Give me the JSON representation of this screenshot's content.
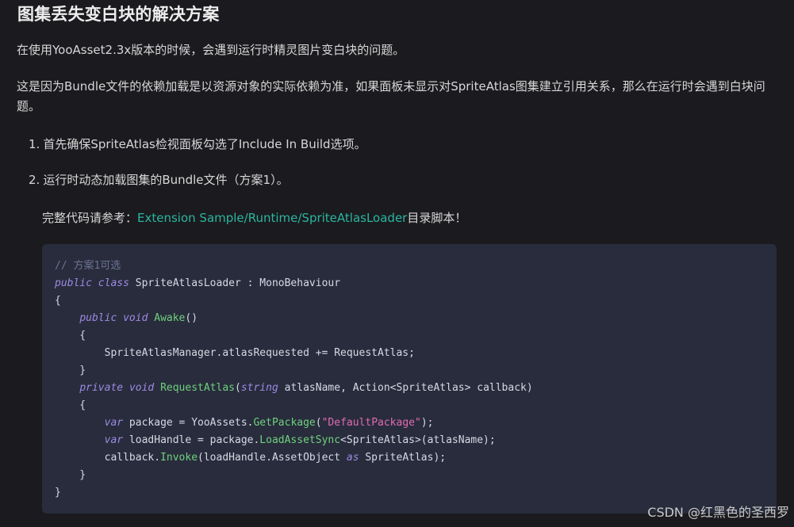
{
  "article": {
    "heading": "图集丢失变白块的解决方案",
    "paragraph1": "在使用YooAsset2.3x版本的时候，会遇到运行时精灵图片变白块的问题。",
    "paragraph2": "这是因为Bundle文件的依赖加载是以资源对象的实际依赖为准，如果面板未显示对SpriteAtlas图集建立引用关系，那么在运行时会遇到白块问题。",
    "list": [
      {
        "num": "1.",
        "text": "首先确保SpriteAtlas检视面板勾选了Include In Build选项。"
      },
      {
        "num": "2.",
        "text": "运行时动态加载图集的Bundle文件（方案1）。"
      }
    ],
    "ref_prefix": "完整代码请参考：",
    "ref_link": "Extension Sample/Runtime/SpriteAtlasLoader",
    "ref_suffix": "目录脚本！"
  },
  "code": {
    "language": "csharp",
    "lines": [
      [
        {
          "t": "// 方案1可选",
          "c": "comment"
        }
      ],
      [
        {
          "t": "public",
          "c": "kw"
        },
        {
          "t": " ",
          "c": "plain"
        },
        {
          "t": "class",
          "c": "kw"
        },
        {
          "t": " SpriteAtlasLoader : MonoBehaviour",
          "c": "plain"
        }
      ],
      [
        {
          "t": "{",
          "c": "plain"
        }
      ],
      [
        {
          "t": "    ",
          "c": "plain"
        },
        {
          "t": "public",
          "c": "kw"
        },
        {
          "t": " ",
          "c": "plain"
        },
        {
          "t": "void",
          "c": "kw"
        },
        {
          "t": " ",
          "c": "plain"
        },
        {
          "t": "Awake",
          "c": "fn"
        },
        {
          "t": "()",
          "c": "plain"
        }
      ],
      [
        {
          "t": "    {",
          "c": "plain"
        }
      ],
      [
        {
          "t": "        SpriteAtlasManager.atlasRequested += RequestAtlas;",
          "c": "plain"
        }
      ],
      [
        {
          "t": "    }",
          "c": "plain"
        }
      ],
      [
        {
          "t": "    ",
          "c": "plain"
        },
        {
          "t": "private",
          "c": "kw"
        },
        {
          "t": " ",
          "c": "plain"
        },
        {
          "t": "void",
          "c": "kw"
        },
        {
          "t": " ",
          "c": "plain"
        },
        {
          "t": "RequestAtlas",
          "c": "fn"
        },
        {
          "t": "(",
          "c": "plain"
        },
        {
          "t": "string",
          "c": "kw"
        },
        {
          "t": " atlasName, Action<SpriteAtlas> callback)",
          "c": "plain"
        }
      ],
      [
        {
          "t": "    {",
          "c": "plain"
        }
      ],
      [
        {
          "t": "        ",
          "c": "plain"
        },
        {
          "t": "var",
          "c": "kw"
        },
        {
          "t": " package = YooAssets.",
          "c": "plain"
        },
        {
          "t": "GetPackage",
          "c": "fn"
        },
        {
          "t": "(",
          "c": "plain"
        },
        {
          "t": "\"DefaultPackage\"",
          "c": "str"
        },
        {
          "t": ");",
          "c": "plain"
        }
      ],
      [
        {
          "t": "        ",
          "c": "plain"
        },
        {
          "t": "var",
          "c": "kw"
        },
        {
          "t": " loadHandle = package.",
          "c": "plain"
        },
        {
          "t": "LoadAssetSync",
          "c": "fn"
        },
        {
          "t": "<SpriteAtlas>(atlasName);",
          "c": "plain"
        }
      ],
      [
        {
          "t": "        callback.",
          "c": "plain"
        },
        {
          "t": "Invoke",
          "c": "fn"
        },
        {
          "t": "(loadHandle.AssetObject ",
          "c": "plain"
        },
        {
          "t": "as",
          "c": "kw"
        },
        {
          "t": " SpriteAtlas);",
          "c": "plain"
        }
      ],
      [
        {
          "t": "    }",
          "c": "plain"
        }
      ],
      [
        {
          "t": "}",
          "c": "plain"
        }
      ]
    ]
  },
  "watermark": "CSDN @红黑色的圣西罗",
  "colors": {
    "background": "#1b1b1f",
    "code_background": "#292c3c",
    "link": "#2bb5a0",
    "keyword": "#9d8ae6",
    "function": "#6fd17f",
    "string": "#e06cb4",
    "comment": "#6b7393"
  }
}
